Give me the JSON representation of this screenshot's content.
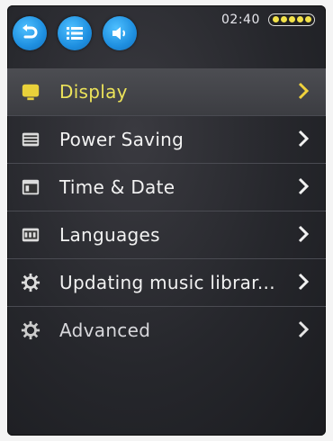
{
  "status": {
    "time": "02:40"
  },
  "topbar": {
    "buttons": [
      {
        "name": "back",
        "icon": "back-arrow-icon"
      },
      {
        "name": "list",
        "icon": "list-icon"
      },
      {
        "name": "volume",
        "icon": "speaker-icon"
      }
    ]
  },
  "menu": {
    "items": [
      {
        "label": "Display",
        "icon": "display-icon",
        "selected": true
      },
      {
        "label": "Power Saving",
        "icon": "power-saving-icon",
        "selected": false
      },
      {
        "label": "Time & Date",
        "icon": "calendar-icon",
        "selected": false
      },
      {
        "label": "Languages",
        "icon": "language-icon",
        "selected": false
      },
      {
        "label": "Updating music librar...",
        "icon": "gear-icon",
        "selected": false
      },
      {
        "label": "Advanced",
        "icon": "gear-icon",
        "selected": false
      }
    ]
  },
  "colors": {
    "selected_text": "#ece35a",
    "accent_button": "#1e8fe0",
    "chevron": "#f0d23c"
  }
}
